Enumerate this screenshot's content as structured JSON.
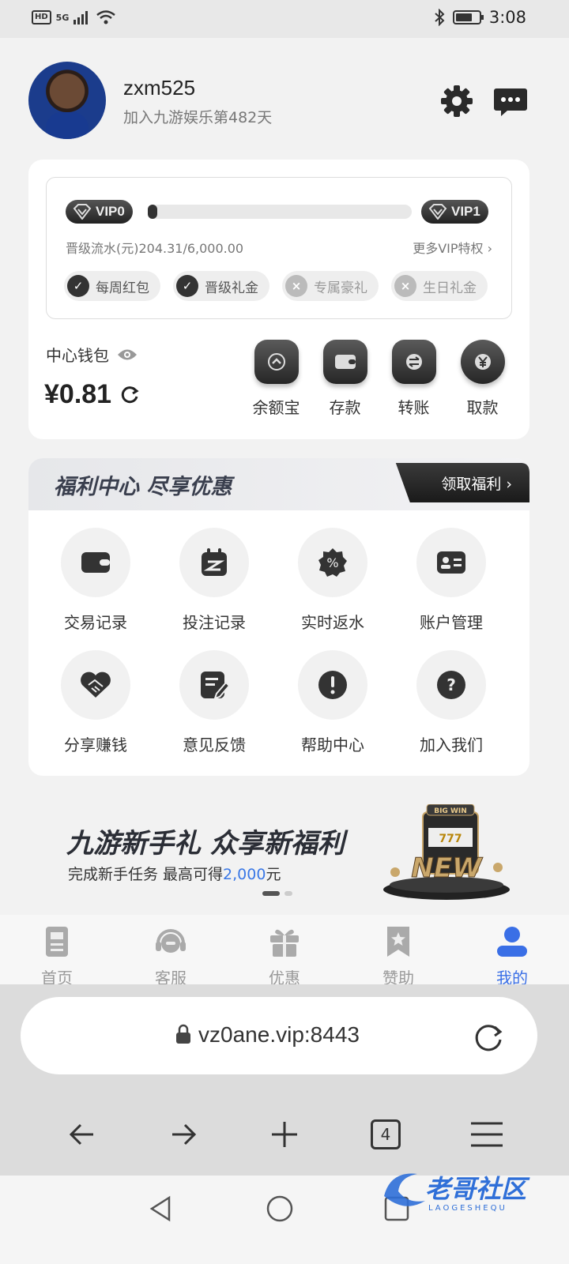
{
  "status_bar": {
    "time": "3:08",
    "network": "5G"
  },
  "profile": {
    "username": "zxm525",
    "joined_text": "加入九游娱乐第482天"
  },
  "vip": {
    "current_level": "VIP0",
    "next_level": "VIP1",
    "progress_text": "晋级流水(元)204.31/6,000.00",
    "progress_fraction": 0.034,
    "more_link": "更多VIP特权 ›",
    "perks": [
      {
        "label": "每周红包",
        "enabled": true
      },
      {
        "label": "晋级礼金",
        "enabled": true
      },
      {
        "label": "专属豪礼",
        "enabled": false
      },
      {
        "label": "生日礼金",
        "enabled": false
      }
    ]
  },
  "wallet": {
    "label": "中心钱包",
    "balance": "¥0.81",
    "actions": [
      {
        "label": "余额宝",
        "icon": "chevron-up-icon"
      },
      {
        "label": "存款",
        "icon": "wallet-icon"
      },
      {
        "label": "转账",
        "icon": "transfer-icon"
      },
      {
        "label": "取款",
        "icon": "yen-icon"
      }
    ]
  },
  "welfare": {
    "title": "福利中心 尽享优惠",
    "claim_button": "领取福利 ›",
    "items": [
      {
        "label": "交易记录",
        "icon": "wallet-icon"
      },
      {
        "label": "投注记录",
        "icon": "calendar-icon"
      },
      {
        "label": "实时返水",
        "icon": "percent-badge-icon"
      },
      {
        "label": "账户管理",
        "icon": "id-card-icon"
      },
      {
        "label": "分享赚钱",
        "icon": "handshake-icon"
      },
      {
        "label": "意见反馈",
        "icon": "edit-note-icon"
      },
      {
        "label": "帮助中心",
        "icon": "exclamation-icon"
      },
      {
        "label": "加入我们",
        "icon": "question-icon"
      }
    ]
  },
  "promo": {
    "title": "九游新手礼 众享新福利",
    "subtitle_prefix": "完成新手任务 最高可得",
    "subtitle_amount": "2,000",
    "subtitle_suffix": "元",
    "art_text": "NEW",
    "art_badge": "BIG WIN"
  },
  "tabbar": {
    "items": [
      {
        "label": "首页",
        "icon": "home-doc-icon",
        "active": false
      },
      {
        "label": "客服",
        "icon": "headset-icon",
        "active": false
      },
      {
        "label": "优惠",
        "icon": "gift-icon",
        "active": false
      },
      {
        "label": "赞助",
        "icon": "bookmark-star-icon",
        "active": false
      },
      {
        "label": "我的",
        "icon": "user-icon",
        "active": true
      }
    ]
  },
  "browser": {
    "url": "vz0ane.vip:8443",
    "tab_count": "4"
  },
  "watermark": {
    "text": "老哥社区",
    "sub": "LAOGESHEQU"
  },
  "colors": {
    "accent": "#3a6fe6",
    "dark": "#2a2a2a",
    "background": "#f2f2f2"
  }
}
